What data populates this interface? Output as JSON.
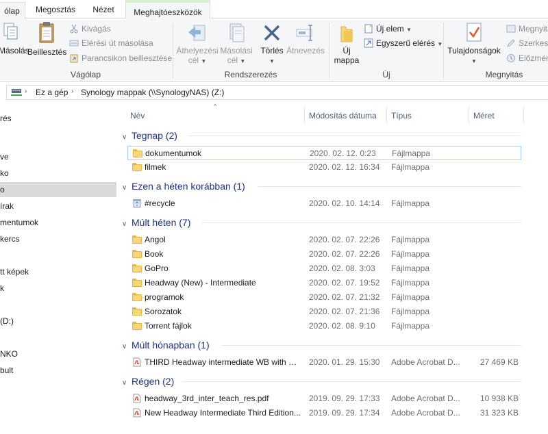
{
  "tabs": [
    {
      "label": "ólap"
    },
    {
      "label": "Megosztás"
    },
    {
      "label": "Nézet"
    },
    {
      "label": "Meghajtóeszközök"
    }
  ],
  "ribbon": {
    "clipboard": {
      "label": "Vágólap",
      "copy": "Másolás",
      "paste": "Beillesztés",
      "cut": "Kivágás",
      "copy_path": "Elérési út másolása",
      "paste_shortcut": "Parancsikon beillesztése"
    },
    "organize": {
      "label": "Rendszerezés",
      "move_to_1": "Áthelyezési",
      "move_to_2": "cél",
      "copy_to_1": "Másolási",
      "copy_to_2": "cél",
      "delete": "Törlés",
      "rename": "Átnevezés"
    },
    "new": {
      "label": "Új",
      "new_folder_1": "Új",
      "new_folder_2": "mappa",
      "new_item": "Új elem",
      "easy_access": "Egyszerű elérés"
    },
    "open": {
      "label": "Megnyitás",
      "properties": "Tulajdonságok",
      "open": "Megnyitás",
      "edit": "Szerkesztés",
      "history": "Előzmények"
    }
  },
  "address": {
    "crumbs": [
      "Ez a gép",
      "Synology mappak (\\\\SynologyNAS) (Z:)"
    ]
  },
  "nav": {
    "items": [
      {
        "label": "rés",
        "selected": false
      },
      {
        "label": "ve",
        "selected": false
      },
      {
        "label": "ko",
        "selected": false
      },
      {
        "label": "o",
        "selected": true
      },
      {
        "label": "írak",
        "selected": false
      },
      {
        "label": "mentumok",
        "selected": false
      },
      {
        "label": "kercs",
        "selected": false
      },
      {
        "label": "tt képek",
        "selected": false
      },
      {
        "label": "k",
        "selected": false
      },
      {
        "label": "(D:)",
        "selected": false
      },
      {
        "label": "NKO",
        "selected": false
      },
      {
        "label": "bult",
        "selected": false
      }
    ]
  },
  "columns": {
    "name": "Név",
    "modified": "Módosítás dátuma",
    "type": "Típus",
    "size": "Méret"
  },
  "groups": [
    {
      "title": "Tegnap (2)",
      "rows": [
        {
          "icon": "folder",
          "name": "dokumentumok",
          "date": "2020. 02. 12. 0:23",
          "type": "Fájlmappa",
          "size": "",
          "focus": true
        },
        {
          "icon": "folder",
          "name": "filmek",
          "date": "2020. 02. 12. 16:34",
          "type": "Fájlmappa",
          "size": ""
        }
      ]
    },
    {
      "title": "Ezen a héten korábban (1)",
      "rows": [
        {
          "icon": "recycle",
          "name": "#recycle",
          "date": "2020. 02. 10. 14:14",
          "type": "Fájlmappa",
          "size": ""
        }
      ]
    },
    {
      "title": "Múlt héten (7)",
      "rows": [
        {
          "icon": "folder",
          "name": "Angol",
          "date": "2020. 02. 07. 22:26",
          "type": "Fájlmappa",
          "size": ""
        },
        {
          "icon": "folder",
          "name": "Book",
          "date": "2020. 02. 07. 22:26",
          "type": "Fájlmappa",
          "size": ""
        },
        {
          "icon": "folder",
          "name": "GoPro",
          "date": "2020. 02. 08. 3:03",
          "type": "Fájlmappa",
          "size": ""
        },
        {
          "icon": "folder",
          "name": "Headway (New) - Intermediate",
          "date": "2020. 02. 07. 19:52",
          "type": "Fájlmappa",
          "size": ""
        },
        {
          "icon": "folder",
          "name": "programok",
          "date": "2020. 02. 07. 21:32",
          "type": "Fájlmappa",
          "size": ""
        },
        {
          "icon": "folder",
          "name": "Sorozatok",
          "date": "2020. 02. 07. 21:36",
          "type": "Fájlmappa",
          "size": ""
        },
        {
          "icon": "folder",
          "name": "Torrent fájlok",
          "date": "2020. 02. 08. 9:10",
          "type": "Fájlmappa",
          "size": ""
        }
      ]
    },
    {
      "title": "Múlt hónapban (1)",
      "rows": [
        {
          "icon": "pdf",
          "name": "THIRD Headway intermediate WB with ke...",
          "date": "2020. 01. 29. 15:30",
          "type": "Adobe Acrobat D...",
          "size": "27 469 KB"
        }
      ]
    },
    {
      "title": "Régen (2)",
      "rows": [
        {
          "icon": "pdf",
          "name": "headway_3rd_inter_teach_res.pdf",
          "date": "2019. 09. 29. 17:33",
          "type": "Adobe Acrobat D...",
          "size": "10 938 KB"
        },
        {
          "icon": "pdf",
          "name": "New Headway Intermediate Third Edition...",
          "date": "2019. 09. 29. 17:34",
          "type": "Adobe Acrobat D...",
          "size": "31 323 KB"
        }
      ]
    }
  ],
  "colors": {
    "group_header": "#1e3287",
    "folder": "#f8d775",
    "pdf": "#d93025",
    "selection_border": "#99d1ff",
    "nav_selected": "#d9d9d9"
  }
}
